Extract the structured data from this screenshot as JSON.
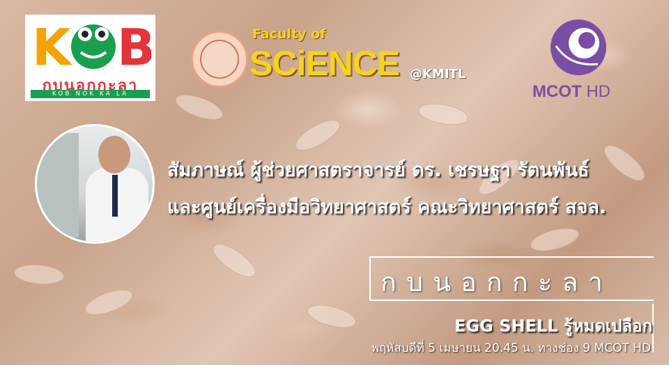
{
  "logos": {
    "kob": {
      "letters": "KOB",
      "thai": "กบนอกกะลา",
      "romanized": "KOB NOK KA LA",
      "colors": {
        "k": "#f6a200",
        "o": "#1a9f4e",
        "b": "#e5333a",
        "band": "#1a9f4e"
      }
    },
    "science": {
      "faculty_of": "Faculty of",
      "science": "SCiENCE",
      "kmitl": "@KMITL",
      "color": "#f7d31a"
    },
    "mcot": {
      "mcot": "MCOT",
      "hd": "HD",
      "color": "#7a4ea3"
    }
  },
  "interview": {
    "line1": "สัมภาษณ์ ผู้ช่วยศาสตราจารย์ ดร. เชรษฐา รัตนพันธ์",
    "line2": "และศูนย์เครื่องมือวิทยาศาสตร์ คณะวิทยาศาสตร์ สจล."
  },
  "program": {
    "title": "กบนอกกะลา",
    "episode": "EGG SHELL รู้หมดเปลือก",
    "air_time": "พฤหัสบดีที่ 5 เมษายน 20.45 น. ทางช่อง 9 MCOT HD"
  }
}
